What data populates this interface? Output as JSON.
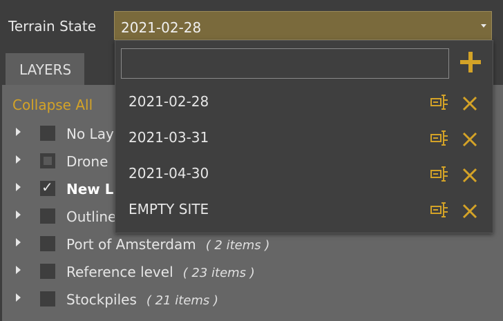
{
  "terrain_state": {
    "label": "Terrain State",
    "selected": "2021-02-28",
    "options": [
      "2021-02-28",
      "2021-03-31",
      "2021-04-30",
      "EMPTY SITE"
    ],
    "search_value": "",
    "accent_color": "#d4a327"
  },
  "tabs": {
    "layers": "LAYERS"
  },
  "layers_panel": {
    "collapse_all": "Collapse All",
    "items": [
      {
        "name": "No Lay",
        "count": "",
        "checked": "unchecked"
      },
      {
        "name": "Drone",
        "count": "",
        "checked": "partial"
      },
      {
        "name": "New L",
        "count": "",
        "checked": "checked"
      },
      {
        "name": "Outline",
        "count": "",
        "checked": "unchecked"
      },
      {
        "name": "Port of Amsterdam",
        "count": "( 2 items )",
        "checked": "unchecked"
      },
      {
        "name": "Reference level",
        "count": "( 23 items )",
        "checked": "unchecked"
      },
      {
        "name": "Stockpiles",
        "count": "( 21 items )",
        "checked": "unchecked"
      }
    ]
  },
  "icons": {
    "add": "plus-icon",
    "rename": "rename-icon",
    "delete": "close-icon",
    "expand": "expand-arrow-icon",
    "dropdown": "chevron-down-icon"
  }
}
